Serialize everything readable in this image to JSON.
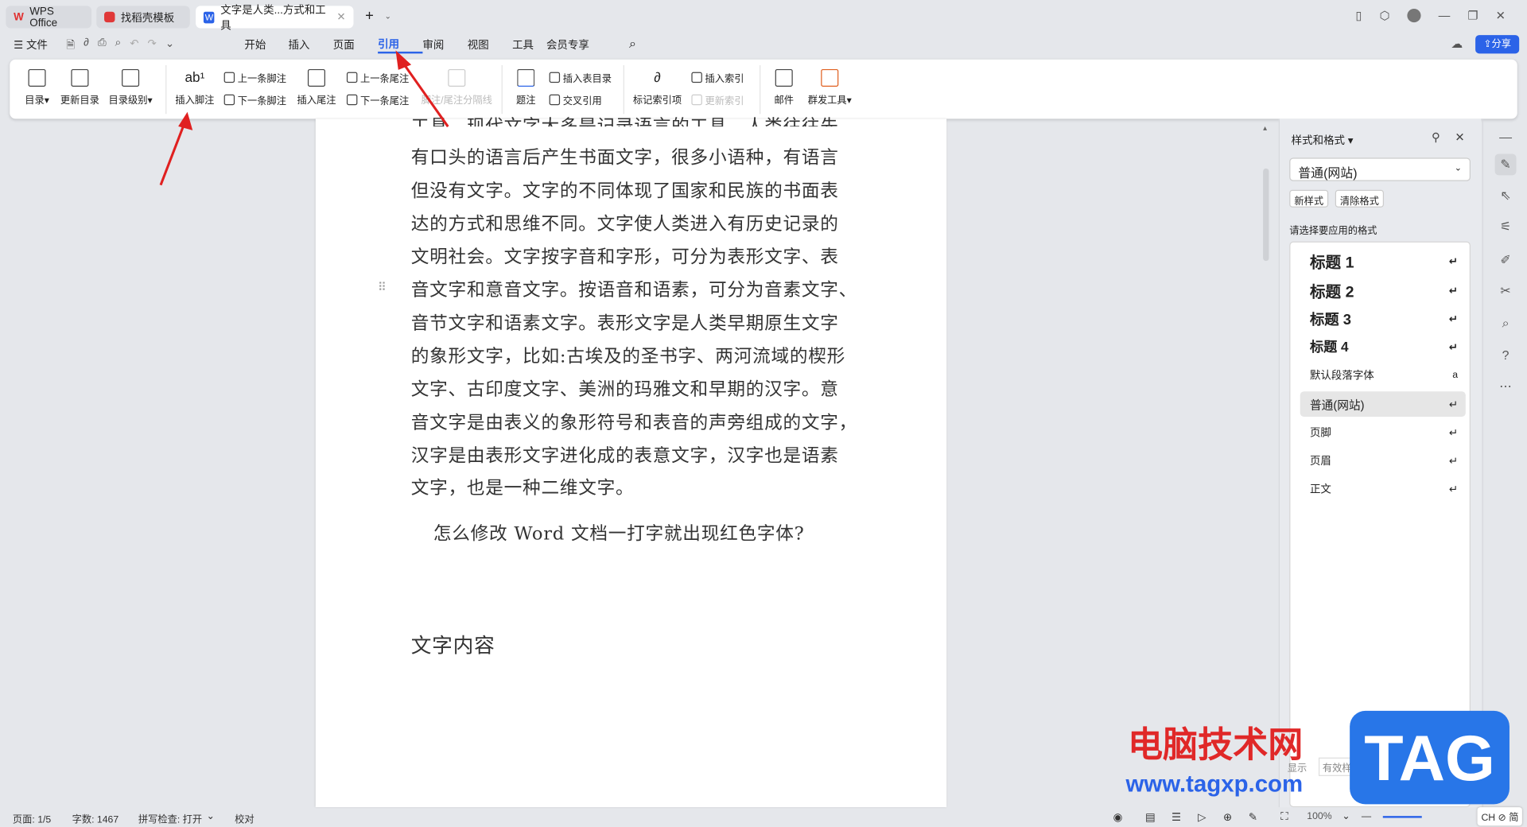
{
  "tabs": [
    {
      "label": "WPS Office"
    },
    {
      "label": "找稻壳模板"
    },
    {
      "label": "文字是人类...方式和工具"
    }
  ],
  "new_tab": "+",
  "menu": {
    "file": "文件",
    "items": [
      "开始",
      "插入",
      "页面",
      "引用",
      "审阅",
      "视图",
      "工具",
      "会员专享"
    ],
    "active": "引用",
    "share": "分享"
  },
  "ribbon": {
    "toc": "目录",
    "update_toc": "更新目录",
    "toc_level": "目录级别",
    "insert_footnote": "插入脚注",
    "prev_footnote": "上一条脚注",
    "next_footnote": "下一条脚注",
    "insert_endnote": "插入尾注",
    "prev_endnote": "上一条尾注",
    "next_endnote": "下一条尾注",
    "separator": "脚注/尾注分隔线",
    "caption": "题注",
    "insert_table_of_figures": "插入表目录",
    "cross_ref": "交叉引用",
    "mark_index": "标记索引项",
    "insert_index": "插入索引",
    "update_index": "更新索引",
    "mail": "邮件",
    "mass_send": "群发工具"
  },
  "document": {
    "lines": [
      "工具。现代文字大多是记录语言的工具。人类往往先",
      "有口头的语言后产生书面文字，很多小语种，有语言",
      "但没有文字。文字的不同体现了国家和民族的书面表",
      "达的方式和思维不同。文字使人类进入有历史记录的",
      "文明社会。文字按字音和字形，可分为表形文字、表",
      "音文字和意音文字。按语音和语素，可分为音素文字、",
      "音节文字和语素文字。表形文字是人类早期原生文字",
      "的象形文字，比如:古埃及的圣书字、两河流域的楔形",
      "文字、古印度文字、美洲的玛雅文和早期的汉字。意",
      "音文字是由表义的象形符号和表音的声旁组成的文字，",
      "汉字是由表形文字进化成的表意文字，汉字也是语素",
      "文字，也是一种二维文字。"
    ],
    "question": "怎么修改 Word 文档一打字就出现红色字体?",
    "heading": "文字内容"
  },
  "styles_panel": {
    "title": "样式和格式",
    "current": "普通(网站)",
    "new_style": "新样式",
    "clear_format": "清除格式",
    "prompt": "请选择要应用的格式",
    "items": [
      {
        "label": "标题 1"
      },
      {
        "label": "标题 2"
      },
      {
        "label": "标题 3"
      },
      {
        "label": "标题 4"
      },
      {
        "label": "默认段落字体"
      },
      {
        "label": "普通(网站)"
      },
      {
        "label": "页脚"
      },
      {
        "label": "页眉"
      },
      {
        "label": "正文"
      }
    ],
    "show": "显示",
    "effective": "有效样式"
  },
  "status": {
    "page": "页面: 1/5",
    "words": "字数: 1467",
    "spell": "拼写检查: 打开",
    "proof": "校对",
    "zoom": "100%",
    "ime": "CH ⊘ 简"
  },
  "watermark": {
    "site": "电脑技术网",
    "url": "www.tagxp.com",
    "logo": "TAG"
  },
  "colors": {
    "accent": "#2b63e8",
    "arrow": "#e02020"
  }
}
